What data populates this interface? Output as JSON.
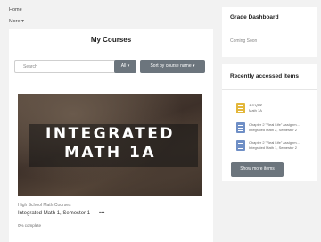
{
  "nav": {
    "home": "Home",
    "more": "More"
  },
  "main": {
    "title": "My Courses",
    "search_placeholder": "Search",
    "filter_label": "All",
    "sort_label": "Sort by course name",
    "course": {
      "image_line1": "INTEGRATED",
      "image_line2": "MATH 1A",
      "category": "High School Math Courses",
      "name": "Integrated Math 1, Semester 1",
      "menu": "•••",
      "progress": "0% complete"
    }
  },
  "sidebar": {
    "grade_dashboard": {
      "title": "Grade Dashboard",
      "status": "Coming Soon"
    },
    "recent": {
      "title": "Recently accessed items",
      "items": [
        {
          "line1": "1.3 Quiz",
          "line2": "Math 1A",
          "color": "#e3b73b"
        },
        {
          "line1": "Chapter 2 \"Real Life\" Assignm...",
          "line2": "Integrated Math 2, Semester 2",
          "color": "#6f8fc6"
        },
        {
          "line1": "Chapter 2 \"Real Life\" Assignm...",
          "line2": "Integrated Math 1, Semester 2",
          "color": "#6f8fc6"
        }
      ],
      "show_more": "Show more items"
    }
  }
}
